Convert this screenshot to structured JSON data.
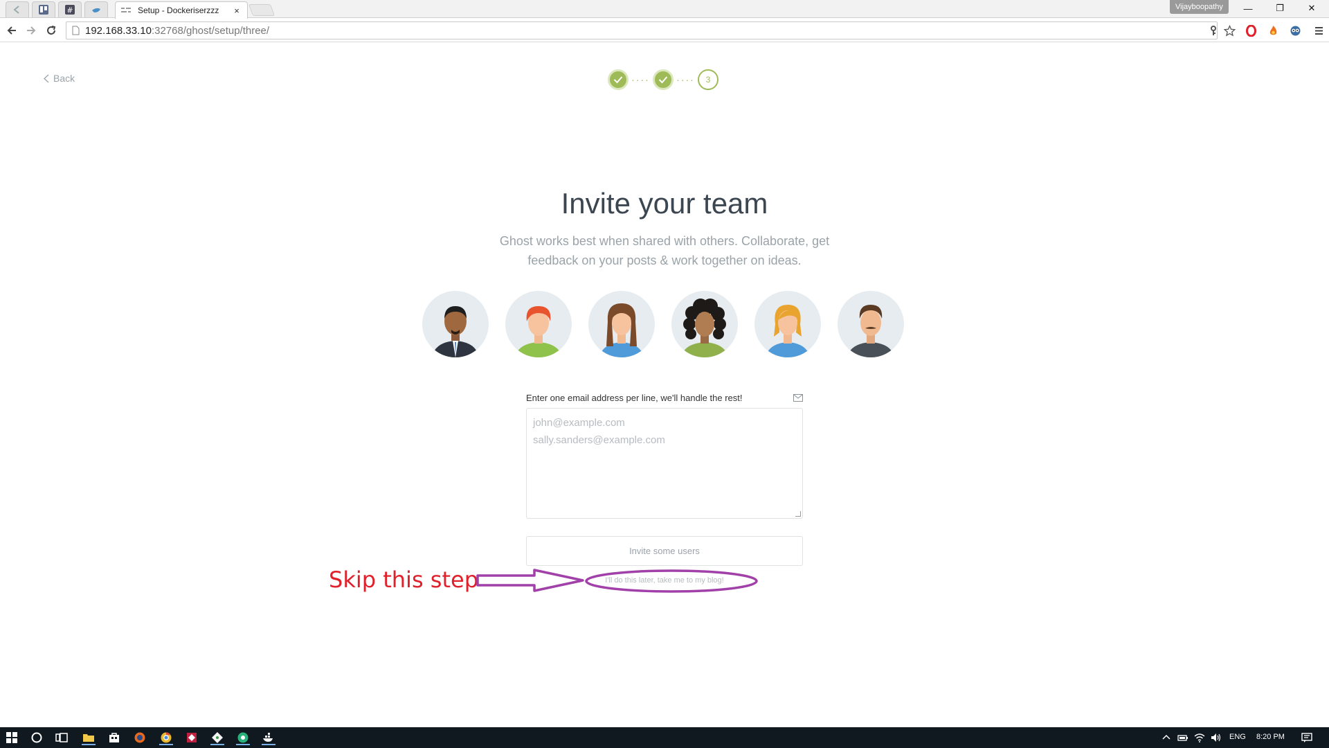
{
  "browser": {
    "tab_title": "Setup - Dockeriserzzz",
    "tab_close": "×",
    "profile_name": "Vijayboopathy",
    "url_host": "192.168.33.10",
    "url_path": ":32768/ghost/setup/three/",
    "window_controls": {
      "minimize": "—",
      "restore": "❐",
      "close": "✕"
    }
  },
  "page": {
    "back_label": "Back",
    "steps": {
      "current_step": "3"
    },
    "headline": "Invite your team",
    "subline": "Ghost works best when shared with others. Collaborate, get feedback on your posts & work together on ideas.",
    "avatars": [
      "avatar-1",
      "avatar-2",
      "avatar-3",
      "avatar-4",
      "avatar-5",
      "avatar-6"
    ],
    "email_label": "Enter one email address per line, we'll handle the rest!",
    "email_placeholder_lines": [
      "john@example.com",
      "sally.sanders@example.com"
    ],
    "invite_button": "Invite some users",
    "skip_link": "I'll do this later, take me to my blog!"
  },
  "annotation": {
    "text": "Skip this step",
    "color": "#e0202a",
    "arrow_color": "#a040a8"
  },
  "taskbar": {
    "language": "ENG",
    "time": "8:20 PM"
  },
  "colors": {
    "accent_green": "#9fbb58",
    "text_muted": "#9aa3a8",
    "headline": "#3c4650"
  }
}
